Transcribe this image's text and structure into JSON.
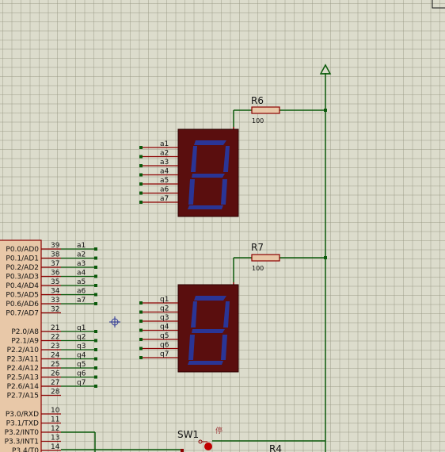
{
  "colors": {
    "background": "#dcdccc",
    "wire": "#0b5a0b",
    "pin": "#8b0000",
    "display_body": "#5a0e0e",
    "segment": "#2a3596",
    "resistor_fill": "#e8c8a8",
    "switch": "#c00000"
  },
  "components": {
    "r6": {
      "ref": "R6",
      "value": "100"
    },
    "r7": {
      "ref": "R7",
      "value": "100"
    },
    "r4": {
      "ref": "R4"
    },
    "sw1": {
      "ref": "SW1",
      "mark": "停"
    }
  },
  "display_top": {
    "pins": [
      "a1",
      "a2",
      "a3",
      "a4",
      "a5",
      "a6",
      "a7"
    ]
  },
  "display_bottom": {
    "pins": [
      "q1",
      "q2",
      "q3",
      "q4",
      "q5",
      "q6",
      "q7"
    ]
  },
  "mcu": {
    "port0": [
      {
        "name": "P0.0/AD0",
        "pin": "39",
        "net": "a1"
      },
      {
        "name": "P0.1/AD1",
        "pin": "38",
        "net": "a2"
      },
      {
        "name": "P0.2/AD2",
        "pin": "37",
        "net": "a3"
      },
      {
        "name": "P0.3/AD3",
        "pin": "36",
        "net": "a4"
      },
      {
        "name": "P0.4/AD4",
        "pin": "35",
        "net": "a5"
      },
      {
        "name": "P0.5/AD5",
        "pin": "34",
        "net": "a6"
      },
      {
        "name": "P0.6/AD6",
        "pin": "33",
        "net": "a7"
      },
      {
        "name": "P0.7/AD7",
        "pin": "32",
        "net": ""
      }
    ],
    "port2": [
      {
        "name": "P2.0/A8",
        "pin": "21",
        "net": "q1"
      },
      {
        "name": "P2.1/A9",
        "pin": "22",
        "net": "q2"
      },
      {
        "name": "P2.2/A10",
        "pin": "23",
        "net": "q3"
      },
      {
        "name": "P2.3/A11",
        "pin": "24",
        "net": "q4"
      },
      {
        "name": "P2.4/A12",
        "pin": "25",
        "net": "q5"
      },
      {
        "name": "P2.5/A13",
        "pin": "26",
        "net": "q6"
      },
      {
        "name": "P2.6/A14",
        "pin": "27",
        "net": "q7"
      },
      {
        "name": "P2.7/A15",
        "pin": "28",
        "net": ""
      }
    ],
    "port3": [
      {
        "name": "P3.0/RXD",
        "pin": "10"
      },
      {
        "name": "P3.1/TXD",
        "pin": "11"
      },
      {
        "name": "P3.2/INT0",
        "pin": "12"
      },
      {
        "name": "P3.3/INT1",
        "pin": "13"
      },
      {
        "name": "P3.4/T0",
        "pin": "14"
      }
    ]
  }
}
